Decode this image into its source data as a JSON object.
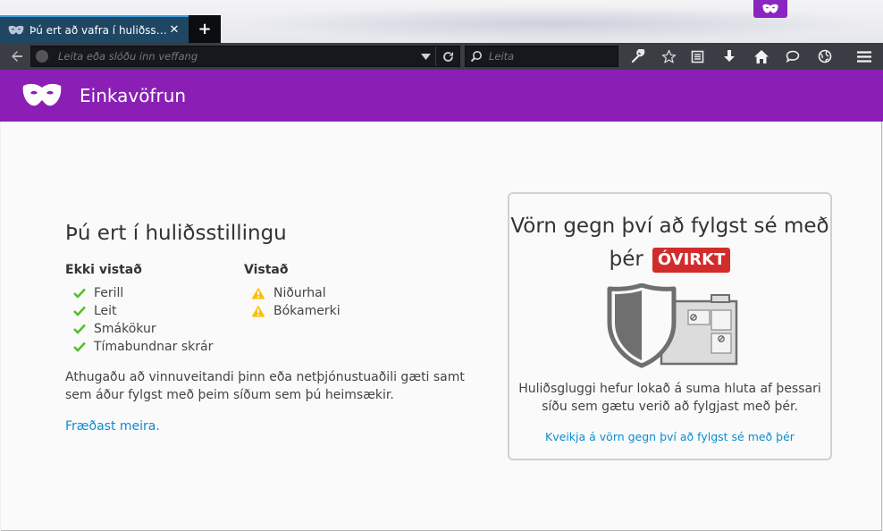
{
  "window": {
    "tab_title": "Þú ert að vafra í huliðsstillingu — Mozilla Firefox",
    "tab_close": "✕",
    "new_tab": "+"
  },
  "toolbar": {
    "url_placeholder": "Leita eða slóðu inn veffang",
    "search_placeholder": "Leita"
  },
  "header": {
    "title": "Einkavöfrun"
  },
  "main": {
    "heading": "Þú ert í huliðsstillingu",
    "not_saved": {
      "title": "Ekki vistað",
      "items": [
        "Ferill",
        "Leit",
        "Smákökur",
        "Tímabundnar skrár"
      ]
    },
    "saved": {
      "title": "Vistað",
      "items": [
        "Niðurhal",
        "Bókamerki"
      ]
    },
    "note": "Athugaðu að vinnuveitandi þinn eða netþjónustuaðili gæti samt sem áður fylgst með þeim síðum sem þú heimsækir.",
    "learn_more": "Fræðast meira."
  },
  "tracking": {
    "title": "Vörn gegn því að fylgst sé með þér",
    "status": "ÓVIRKT",
    "description": "Huliðsgluggi hefur lokað á suma hluta af þessari síðu sem gætu verið að fylgjast með þér.",
    "enable_link": "Kveikja á vörn gegn því að fylgst sé með þér"
  },
  "colors": {
    "accent_purple": "#8b1fb5",
    "link_blue": "#0a8dcf",
    "check_green": "#57bd35",
    "warning_yellow": "#ffbf00",
    "status_red": "#d22b2b"
  },
  "icons": [
    "mask-icon",
    "check-icon",
    "warning-icon",
    "back-icon",
    "reload-icon",
    "search-icon",
    "wrench-icon",
    "star-icon",
    "reader-icon",
    "download-icon",
    "home-icon",
    "chat-icon",
    "globe-icon",
    "menu-icon",
    "shield-icon"
  ]
}
